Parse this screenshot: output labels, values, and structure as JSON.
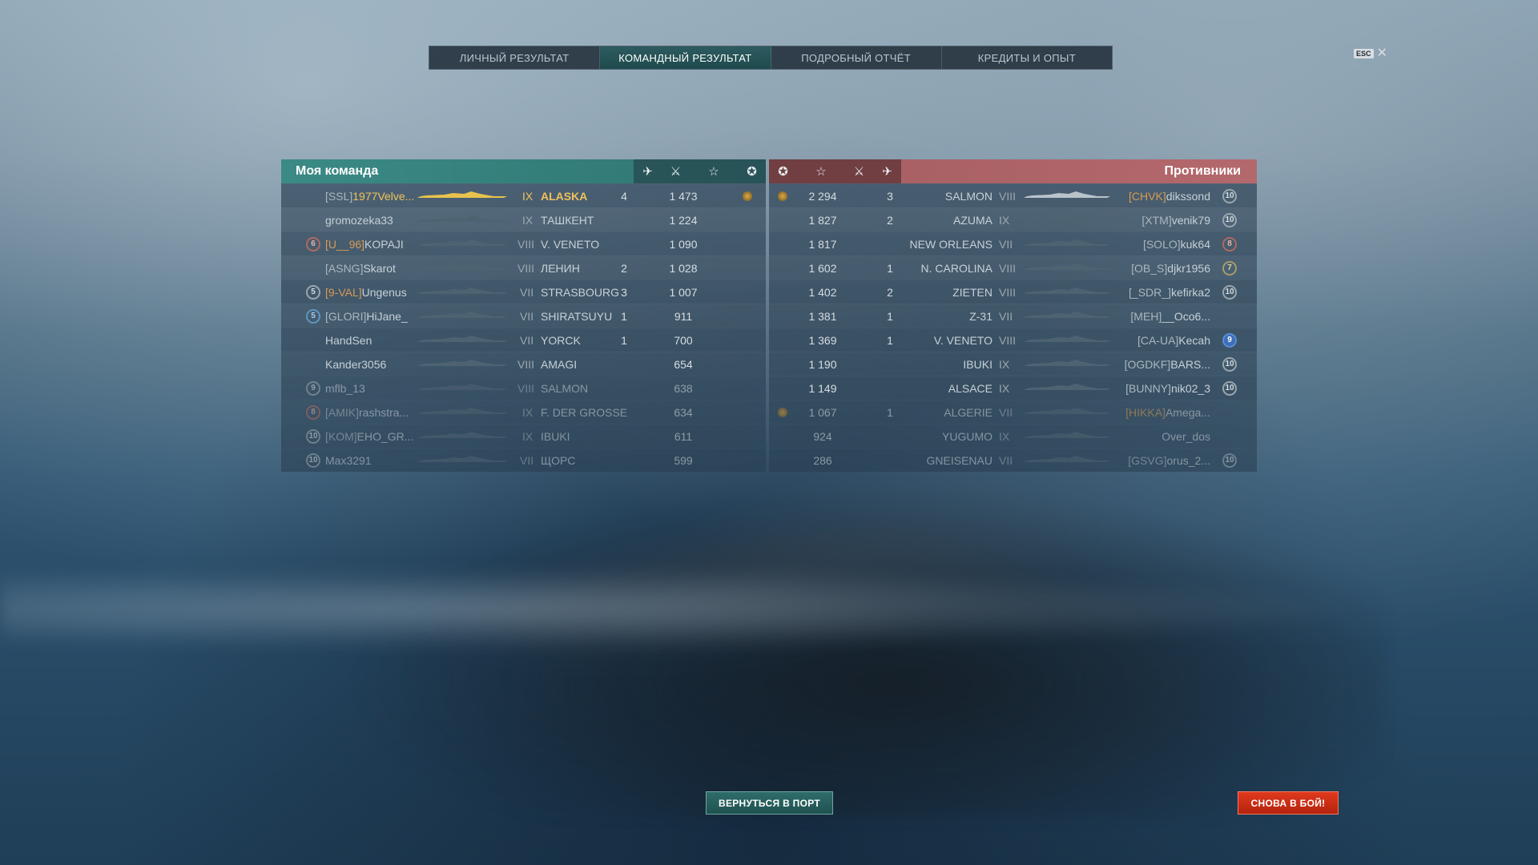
{
  "tabs": [
    {
      "label": "ЛИЧНЫЙ РЕЗУЛЬТАТ",
      "active": false
    },
    {
      "label": "КОМАНДНЫЙ РЕЗУЛЬТАТ",
      "active": true
    },
    {
      "label": "ПОДРОБНЫЙ ОТЧЁТ",
      "active": false
    },
    {
      "label": "КРЕДИТЫ И ОПЫТ",
      "active": false
    }
  ],
  "esc_label": "ESC",
  "close_glyph": "✕",
  "my_team": {
    "title": "Моя команда",
    "colors": {
      "header": "#3b8a86"
    },
    "rows": [
      {
        "rank": "",
        "clan": "[SSL]",
        "name": "1977Velve...",
        "tier": "IX",
        "ship": "ALASKA",
        "kills": "4",
        "xp": "1 473",
        "medal": true,
        "me": true
      },
      {
        "rank": "",
        "clan": "",
        "name": "gromozeka33",
        "tier": "IX",
        "ship": "ТАШКЕНТ",
        "kills": "",
        "xp": "1 224",
        "medal": false
      },
      {
        "rank": "6",
        "clan": "[U__96]",
        "name": "KOPAJI",
        "tier": "VIII",
        "ship": "V. VENETO",
        "kills": "",
        "xp": "1 090",
        "medal": false,
        "clan_gold": true
      },
      {
        "rank": "",
        "clan": "[ASNG]",
        "name": "Skarot",
        "tier": "VIII",
        "ship": "ЛЕНИН",
        "kills": "2",
        "xp": "1 028",
        "medal": false
      },
      {
        "rank": "5",
        "clan": "[9-VAL]",
        "name": "Ungenus",
        "tier": "VII",
        "ship": "STRASBOURG",
        "kills": "3",
        "xp": "1 007",
        "medal": false,
        "clan_gold": true
      },
      {
        "rank": "5",
        "clan": "[GLORI]",
        "name": "HiJane_",
        "tier": "VII",
        "ship": "SHIRATSUYU",
        "kills": "1",
        "xp": "911",
        "medal": false,
        "rank_blue": true
      },
      {
        "rank": "",
        "clan": "",
        "name": "HandSen",
        "tier": "VII",
        "ship": "YORCK",
        "kills": "1",
        "xp": "700",
        "medal": false
      },
      {
        "rank": "",
        "clan": "",
        "name": "Kander3056",
        "tier": "VIII",
        "ship": "AMAGI",
        "kills": "",
        "xp": "654",
        "medal": false
      },
      {
        "rank": "9",
        "clan": "",
        "name": "mflb_13",
        "tier": "VIII",
        "ship": "SALMON",
        "kills": "",
        "xp": "638",
        "medal": false,
        "dim": true
      },
      {
        "rank": "8",
        "clan": "[AMIK]",
        "name": "rashstra...",
        "tier": "IX",
        "ship": "F. DER GROSSE",
        "kills": "",
        "xp": "634",
        "medal": false,
        "dim": true
      },
      {
        "rank": "10",
        "clan": "[KOM]",
        "name": "EHO_GR...",
        "tier": "IX",
        "ship": "IBUKI",
        "kills": "",
        "xp": "611",
        "medal": false,
        "dim": true
      },
      {
        "rank": "10",
        "clan": "",
        "name": "Max3291",
        "tier": "VII",
        "ship": "ЩОРС",
        "kills": "",
        "xp": "599",
        "medal": false,
        "dim": true
      }
    ]
  },
  "enemy_team": {
    "title": "Противники",
    "colors": {
      "header": "#a65e63"
    },
    "rows": [
      {
        "medal": true,
        "xp": "2 294",
        "kills": "3",
        "ship": "SALMON",
        "tier": "VIII",
        "clan": "[CHVK]",
        "name": "dikssond",
        "rank": "10",
        "clan_gold": true
      },
      {
        "medal": false,
        "xp": "1 827",
        "kills": "2",
        "ship": "AZUMA",
        "tier": "IX",
        "clan": "[XTM]",
        "name": "venik79",
        "rank": "10"
      },
      {
        "medal": false,
        "xp": "1 817",
        "kills": "",
        "ship": "NEW ORLEANS",
        "tier": "VII",
        "clan": "[SOLO]",
        "name": "kuk64",
        "rank": "8"
      },
      {
        "medal": false,
        "xp": "1 602",
        "kills": "1",
        "ship": "N. CAROLINA",
        "tier": "VIII",
        "clan": "[OB_S]",
        "name": "djkr1956",
        "rank": "7"
      },
      {
        "medal": false,
        "xp": "1 402",
        "kills": "2",
        "ship": "ZIETEN",
        "tier": "VIII",
        "clan": "[_SDR_]",
        "name": "kefirka2",
        "rank": "10"
      },
      {
        "medal": false,
        "xp": "1 381",
        "kills": "1",
        "ship": "Z-31",
        "tier": "VII",
        "clan": "[MEH]",
        "name": "__Oco6...",
        "rank": ""
      },
      {
        "medal": false,
        "xp": "1 369",
        "kills": "1",
        "ship": "V. VENETO",
        "tier": "VIII",
        "clan": "[CA-UA]",
        "name": "Kecah",
        "rank": "9",
        "rank_blue": true
      },
      {
        "medal": false,
        "xp": "1 190",
        "kills": "",
        "ship": "IBUKI",
        "tier": "IX",
        "clan": "[OGDKF]",
        "name": "BARS...",
        "rank": "10"
      },
      {
        "medal": false,
        "xp": "1 149",
        "kills": "",
        "ship": "ALSACE",
        "tier": "IX",
        "clan": "[BUNNY]",
        "name": "nik02_3",
        "rank": "10"
      },
      {
        "medal": true,
        "xp": "1 067",
        "kills": "1",
        "ship": "ALGERIE",
        "tier": "VII",
        "clan": "[HIKKA]",
        "name": "Amega...",
        "rank": "",
        "clan_gold": true,
        "dim": true
      },
      {
        "medal": false,
        "xp": "924",
        "kills": "",
        "ship": "YUGUMO",
        "tier": "IX",
        "clan": "",
        "name": "Over_dos",
        "rank": "",
        "dim": true
      },
      {
        "medal": false,
        "xp": "286",
        "kills": "",
        "ship": "GNEISENAU",
        "tier": "VII",
        "clan": "[GSVG]",
        "name": "orus_2...",
        "rank": "10",
        "dim": true
      }
    ]
  },
  "buttons": {
    "return_port": "ВЕРНУТЬСЯ В ПОРТ",
    "fight_again": "СНОВА В БОЙ!"
  },
  "icons": {
    "planes": "plane-icon",
    "kills": "crossed-swords-icon",
    "xp": "star-icon",
    "medal": "medal-icon"
  }
}
